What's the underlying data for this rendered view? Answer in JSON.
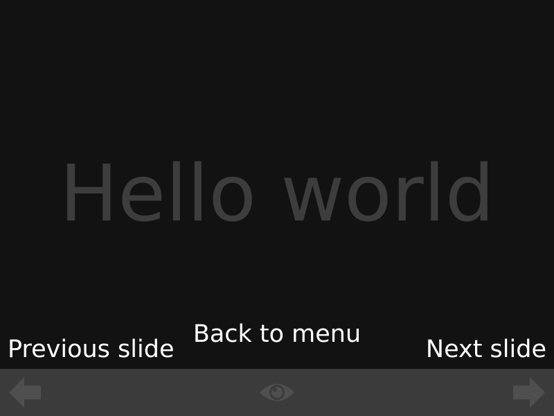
{
  "slide": {
    "title": "Hello world"
  },
  "hints": {
    "previous": "Previous slide",
    "menu": "Back to menu",
    "next": "Next slide"
  },
  "toolbar": {
    "prev_icon": "left-arrow-icon",
    "menu_icon": "eye-icon",
    "next_icon": "right-arrow-icon"
  },
  "colors": {
    "background": "#121212",
    "title": "#3d3d3d",
    "toolbar": "#3b3b3b",
    "toolbar_icon": "#4f4f4f",
    "hint_text": "#ffffff"
  }
}
